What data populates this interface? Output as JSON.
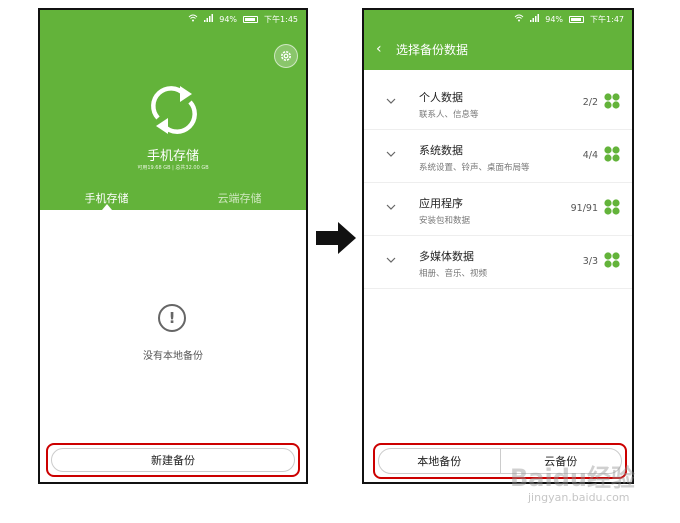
{
  "left_phone": {
    "status_bar": {
      "battery": "94%",
      "time": "下午1:45"
    },
    "title": "手机存储",
    "subtitle": "可用19.68 GB | 总共32.00 GB",
    "tabs": [
      {
        "label": "手机存储",
        "active": true
      },
      {
        "label": "云端存储",
        "active": false
      }
    ],
    "empty_message": "没有本地备份",
    "new_backup_button": "新建备份"
  },
  "right_phone": {
    "status_bar": {
      "battery": "94%",
      "time": "下午1:47"
    },
    "header_title": "选择备份数据",
    "items": [
      {
        "title": "个人数据",
        "description": "联系人、信息等",
        "count": "2/2"
      },
      {
        "title": "系统数据",
        "description": "系统设置、铃声、桌面布局等",
        "count": "4/4"
      },
      {
        "title": "应用程序",
        "description": "安装包和数据",
        "count": "91/91"
      },
      {
        "title": "多媒体数据",
        "description": "相册、音乐、视频",
        "count": "3/3"
      }
    ],
    "local_backup_button": "本地备份",
    "cloud_backup_button": "云备份"
  },
  "watermark": {
    "logo": "Baidu经验",
    "url": "jingyan.baidu.com"
  },
  "colors": {
    "brand_green": "#63b33a",
    "highlight_red": "#cc0000"
  },
  "icons": [
    "wifi-icon",
    "signal-icon",
    "battery-icon",
    "gear-icon",
    "sync-icon",
    "alert-circle-icon",
    "back-icon",
    "chevron-down-icon",
    "clover-check-icon",
    "right-arrow-icon"
  ]
}
